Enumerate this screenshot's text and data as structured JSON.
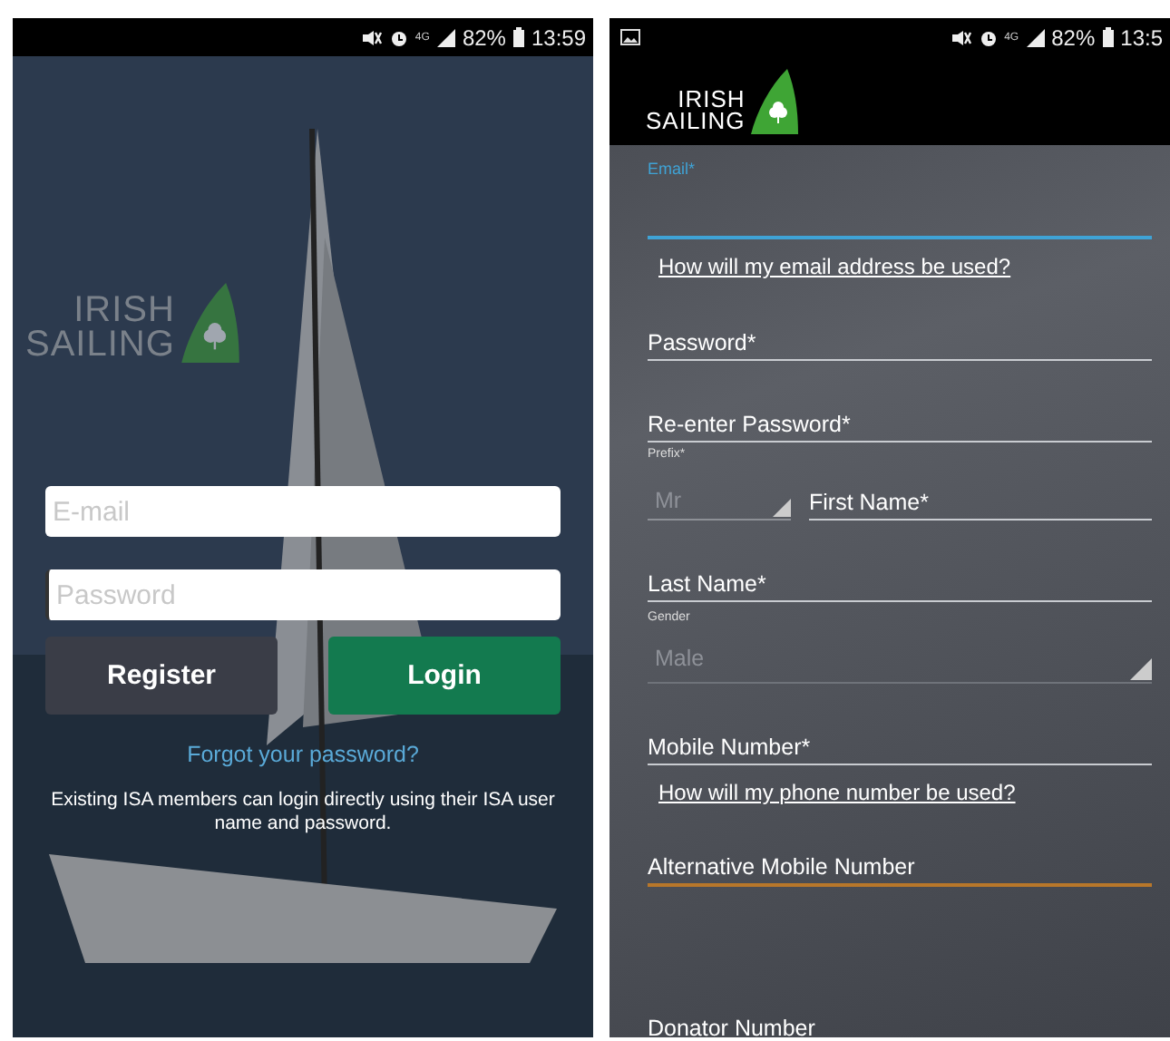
{
  "login_screen": {
    "status_bar": {
      "network": "4G",
      "battery": "82%",
      "time": "13:59"
    },
    "logo": {
      "line_1": "IRISH",
      "line_2": "SAILING"
    },
    "email_field": {
      "placeholder": "E-mail",
      "focused": false
    },
    "password_field": {
      "placeholder": "Password",
      "focused": true
    },
    "buttons": [
      {
        "label": "Register",
        "kind": "secondary"
      },
      {
        "label": "Login",
        "kind": "primary"
      }
    ],
    "forgot_link": "Forgot your password?",
    "note": "Existing ISA members can login directly using their ISA user name and password."
  },
  "register_screen": {
    "status_bar": {
      "network": "4G",
      "battery": "82%",
      "time": "13:5"
    },
    "logo": {
      "line_1": "IRISH",
      "line_2": "SAILING"
    },
    "fields": [
      {
        "kind": "text",
        "label": "Email*",
        "focused": true,
        "highlighted": false
      },
      {
        "kind": "link",
        "label": "How will my email address be used?"
      },
      {
        "kind": "text",
        "label": "Password*",
        "focused": false,
        "highlighted": false
      },
      {
        "kind": "text",
        "label": "Re-enter Password*",
        "focused": false,
        "highlighted": false
      },
      {
        "kind": "prefix_row",
        "prefix_label": "Prefix*",
        "prefix_value": "Mr",
        "name_label": "First Name*"
      },
      {
        "kind": "text",
        "label": "Last Name*",
        "focused": false,
        "highlighted": false
      },
      {
        "kind": "select",
        "label": "Gender",
        "value": "Male"
      },
      {
        "kind": "text",
        "label": "Mobile Number*",
        "focused": false,
        "highlighted": false
      },
      {
        "kind": "link",
        "label": "How will my phone number be used?"
      },
      {
        "kind": "text",
        "label": "Alternative Mobile Number",
        "focused": false,
        "highlighted": true
      },
      {
        "kind": "spacer_text",
        "label": "Donator Number",
        "focused": false,
        "highlighted": false
      }
    ]
  }
}
